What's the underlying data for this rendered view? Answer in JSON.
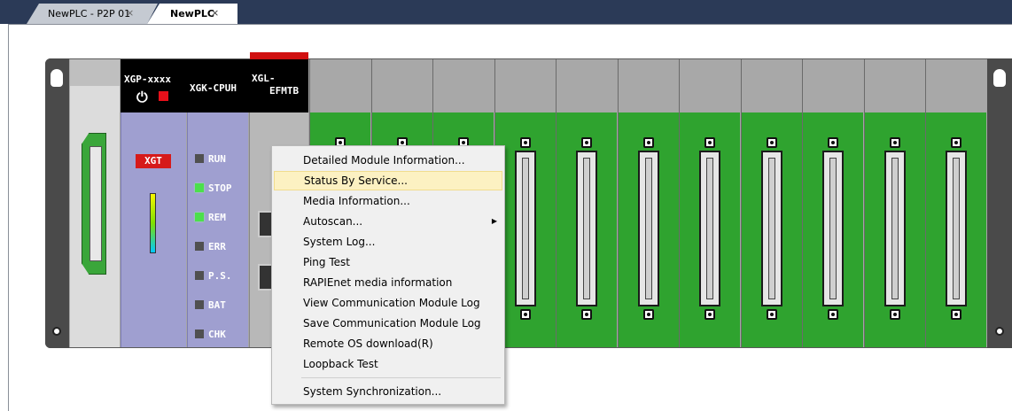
{
  "tabs": [
    {
      "label": "NewPLC - P2P 01",
      "close": "×"
    },
    {
      "label": "NewPLC",
      "close": "×"
    }
  ],
  "modules": {
    "cpu": {
      "name": "XGP-xxxx",
      "badge": "XGT"
    },
    "cpuh": {
      "name": "XGK-CPUH",
      "leds": [
        "RUN",
        "STOP",
        "REM",
        "ERR",
        "P.S.",
        "BAT",
        "CHK"
      ],
      "leds_on": [
        "STOP",
        "REM"
      ]
    },
    "efmtb": {
      "name_line1": "XGL-",
      "name_line2": "EFMTB"
    }
  },
  "io_slot_count": 11,
  "context_menu": {
    "items": [
      "Detailed Module Information...",
      "Status By Service...",
      "Media Information...",
      "Autoscan...",
      "System Log...",
      "Ping Test",
      "RAPIEnet media information",
      "View Communication Module Log",
      "Save Communication Module Log",
      "Remote OS download(R)",
      "Loopback Test",
      "System Synchronization..."
    ],
    "highlighted": "Status By Service...",
    "submenu_item": "Autoscan..."
  },
  "colors": {
    "tabbar": "#2b3a57",
    "io_module": "#2fa32f",
    "cpu_module": "#9f9fd0",
    "menu_highlight": "#fcf1c2",
    "led_on": "#4be04b",
    "xgt_red": "#d61a1a"
  }
}
